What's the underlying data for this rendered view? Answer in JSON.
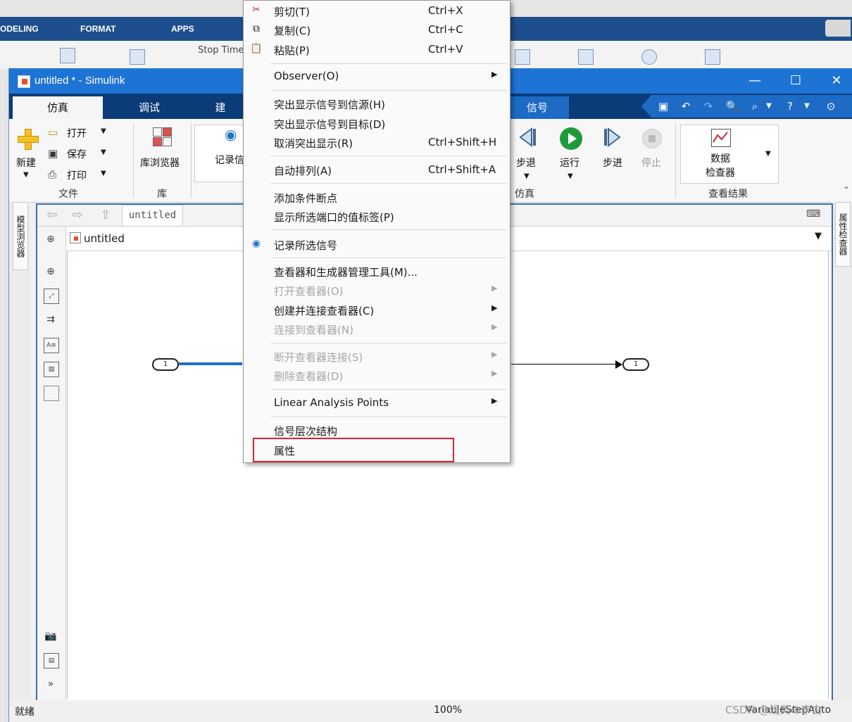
{
  "background_app": {
    "tabs": [
      "ODELING",
      "FORMAT",
      "APPS"
    ],
    "stop_time_label": "Stop Time"
  },
  "window": {
    "title": "untitled * - Simulink",
    "minimize": "—",
    "maximize": "☐",
    "close": "✕"
  },
  "tabs": {
    "simulation": "仿真",
    "debug": "调试",
    "build": "建",
    "signal": "信号"
  },
  "ribbon": {
    "new": "新建",
    "open": "打开",
    "save": "保存",
    "print": "打印",
    "file_section": "文件",
    "library_browser": "库浏览器",
    "library_section": "库",
    "record": "记录信",
    "step_back": "步退",
    "run": "运行",
    "step_forward": "步进",
    "stop": "停止",
    "simulate_section": "仿真",
    "data_inspector_1": "数据",
    "data_inspector_2": "检查器",
    "review_section": "查看结果"
  },
  "side_panels": {
    "left": "模型浏览器",
    "right": "属性检查器"
  },
  "editor": {
    "nav_tab": "untitled",
    "address": "untitled",
    "in_port": "1",
    "out_port": "1"
  },
  "status": {
    "state": "就绪",
    "zoom": "100%",
    "solver": "VariableStepAuto"
  },
  "watermark": "CSDN @浅笑の李白",
  "context_menu": {
    "items": [
      {
        "label": "剪切(T)",
        "shortcut": "Ctrl+X",
        "icon": "scissors-icon"
      },
      {
        "label": "复制(C)",
        "shortcut": "Ctrl+C",
        "icon": "copy-icon"
      },
      {
        "label": "粘贴(P)",
        "shortcut": "Ctrl+V",
        "icon": "paste-icon"
      },
      {
        "label": "Observer(O)"
      },
      {
        "label": "突出显示信号到信源(H)"
      },
      {
        "label": "突出显示信号到目标(D)"
      },
      {
        "label": "取消突出显示(R)",
        "shortcut": "Ctrl+Shift+H"
      },
      {
        "label": "自动排列(A)",
        "shortcut": "Ctrl+Shift+A"
      },
      {
        "label": "添加条件断点"
      },
      {
        "label": "显示所选端口的值标签(P)"
      },
      {
        "label": "记录所选信号",
        "icon": "wifi-icon"
      },
      {
        "label": "查看器和生成器管理工具(M)..."
      },
      {
        "label": "打开查看器(O)",
        "disabled": true
      },
      {
        "label": "创建并连接查看器(C)"
      },
      {
        "label": "连接到查看器(N)",
        "disabled": true
      },
      {
        "label": "断开查看器连接(S)",
        "disabled": true
      },
      {
        "label": "删除查看器(D)",
        "disabled": true
      },
      {
        "label": "Linear Analysis Points"
      },
      {
        "label": "信号层次结构"
      },
      {
        "label": "属性"
      }
    ],
    "highlight_color": "#e0222b"
  }
}
